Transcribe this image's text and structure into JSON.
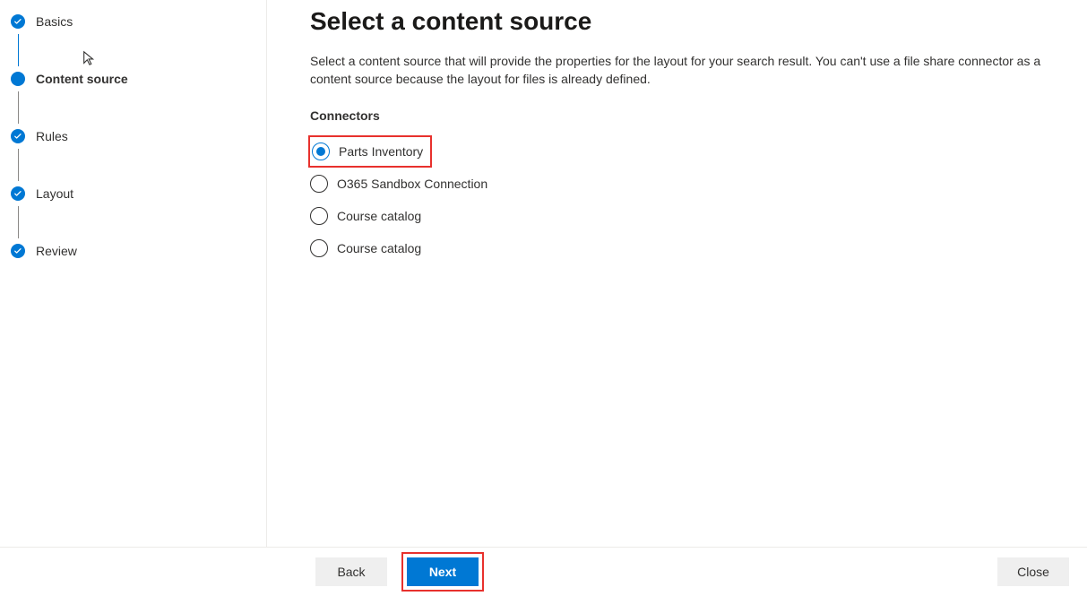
{
  "sidebar": {
    "steps": [
      {
        "label": "Basics",
        "state": "done"
      },
      {
        "label": "Content source",
        "state": "current"
      },
      {
        "label": "Rules",
        "state": "done"
      },
      {
        "label": "Layout",
        "state": "done"
      },
      {
        "label": "Review",
        "state": "done"
      }
    ]
  },
  "main": {
    "title": "Select a content source",
    "description": "Select a content source that will provide the properties for the layout for your search result. You can't use a file share connector as a content source because the layout for files is already defined.",
    "section_label": "Connectors",
    "connectors": [
      {
        "label": "Parts Inventory",
        "selected": true,
        "highlighted": true
      },
      {
        "label": "O365 Sandbox Connection",
        "selected": false,
        "highlighted": false
      },
      {
        "label": "Course catalog",
        "selected": false,
        "highlighted": false
      },
      {
        "label": "Course catalog",
        "selected": false,
        "highlighted": false
      }
    ]
  },
  "footer": {
    "back": "Back",
    "next": "Next",
    "close": "Close"
  }
}
